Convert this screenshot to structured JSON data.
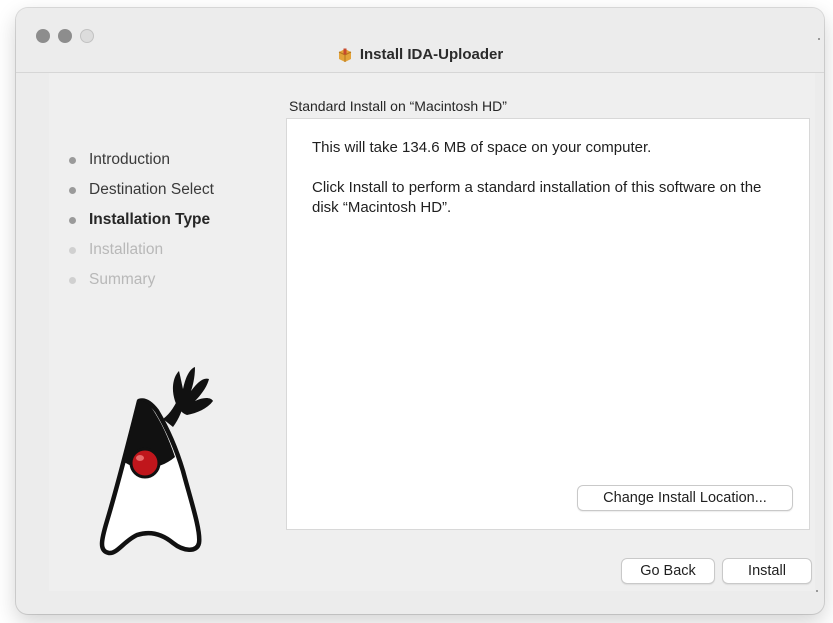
{
  "window": {
    "title": "Install IDA-Uploader",
    "title_icon": "package-icon"
  },
  "sidebar": {
    "steps": [
      {
        "label": "Introduction",
        "state": "done"
      },
      {
        "label": "Destination Select",
        "state": "done"
      },
      {
        "label": "Installation Type",
        "state": "current"
      },
      {
        "label": "Installation",
        "state": "pending"
      },
      {
        "label": "Summary",
        "state": "pending"
      }
    ]
  },
  "main": {
    "heading": "Standard Install on “Macintosh HD”",
    "line1": "This will take 134.6 MB of space on your computer.",
    "line2": "Click Install to perform a standard installation of this software on the disk “Macintosh HD”.",
    "change_location_label": "Change Install Location..."
  },
  "footer": {
    "back_label": "Go Back",
    "install_label": "Install"
  },
  "colors": {
    "window_bg": "#ececec",
    "panel_bg": "#ffffff",
    "mascot_red": "#c0161c",
    "traffic_inactive": "#8d8d8d"
  }
}
